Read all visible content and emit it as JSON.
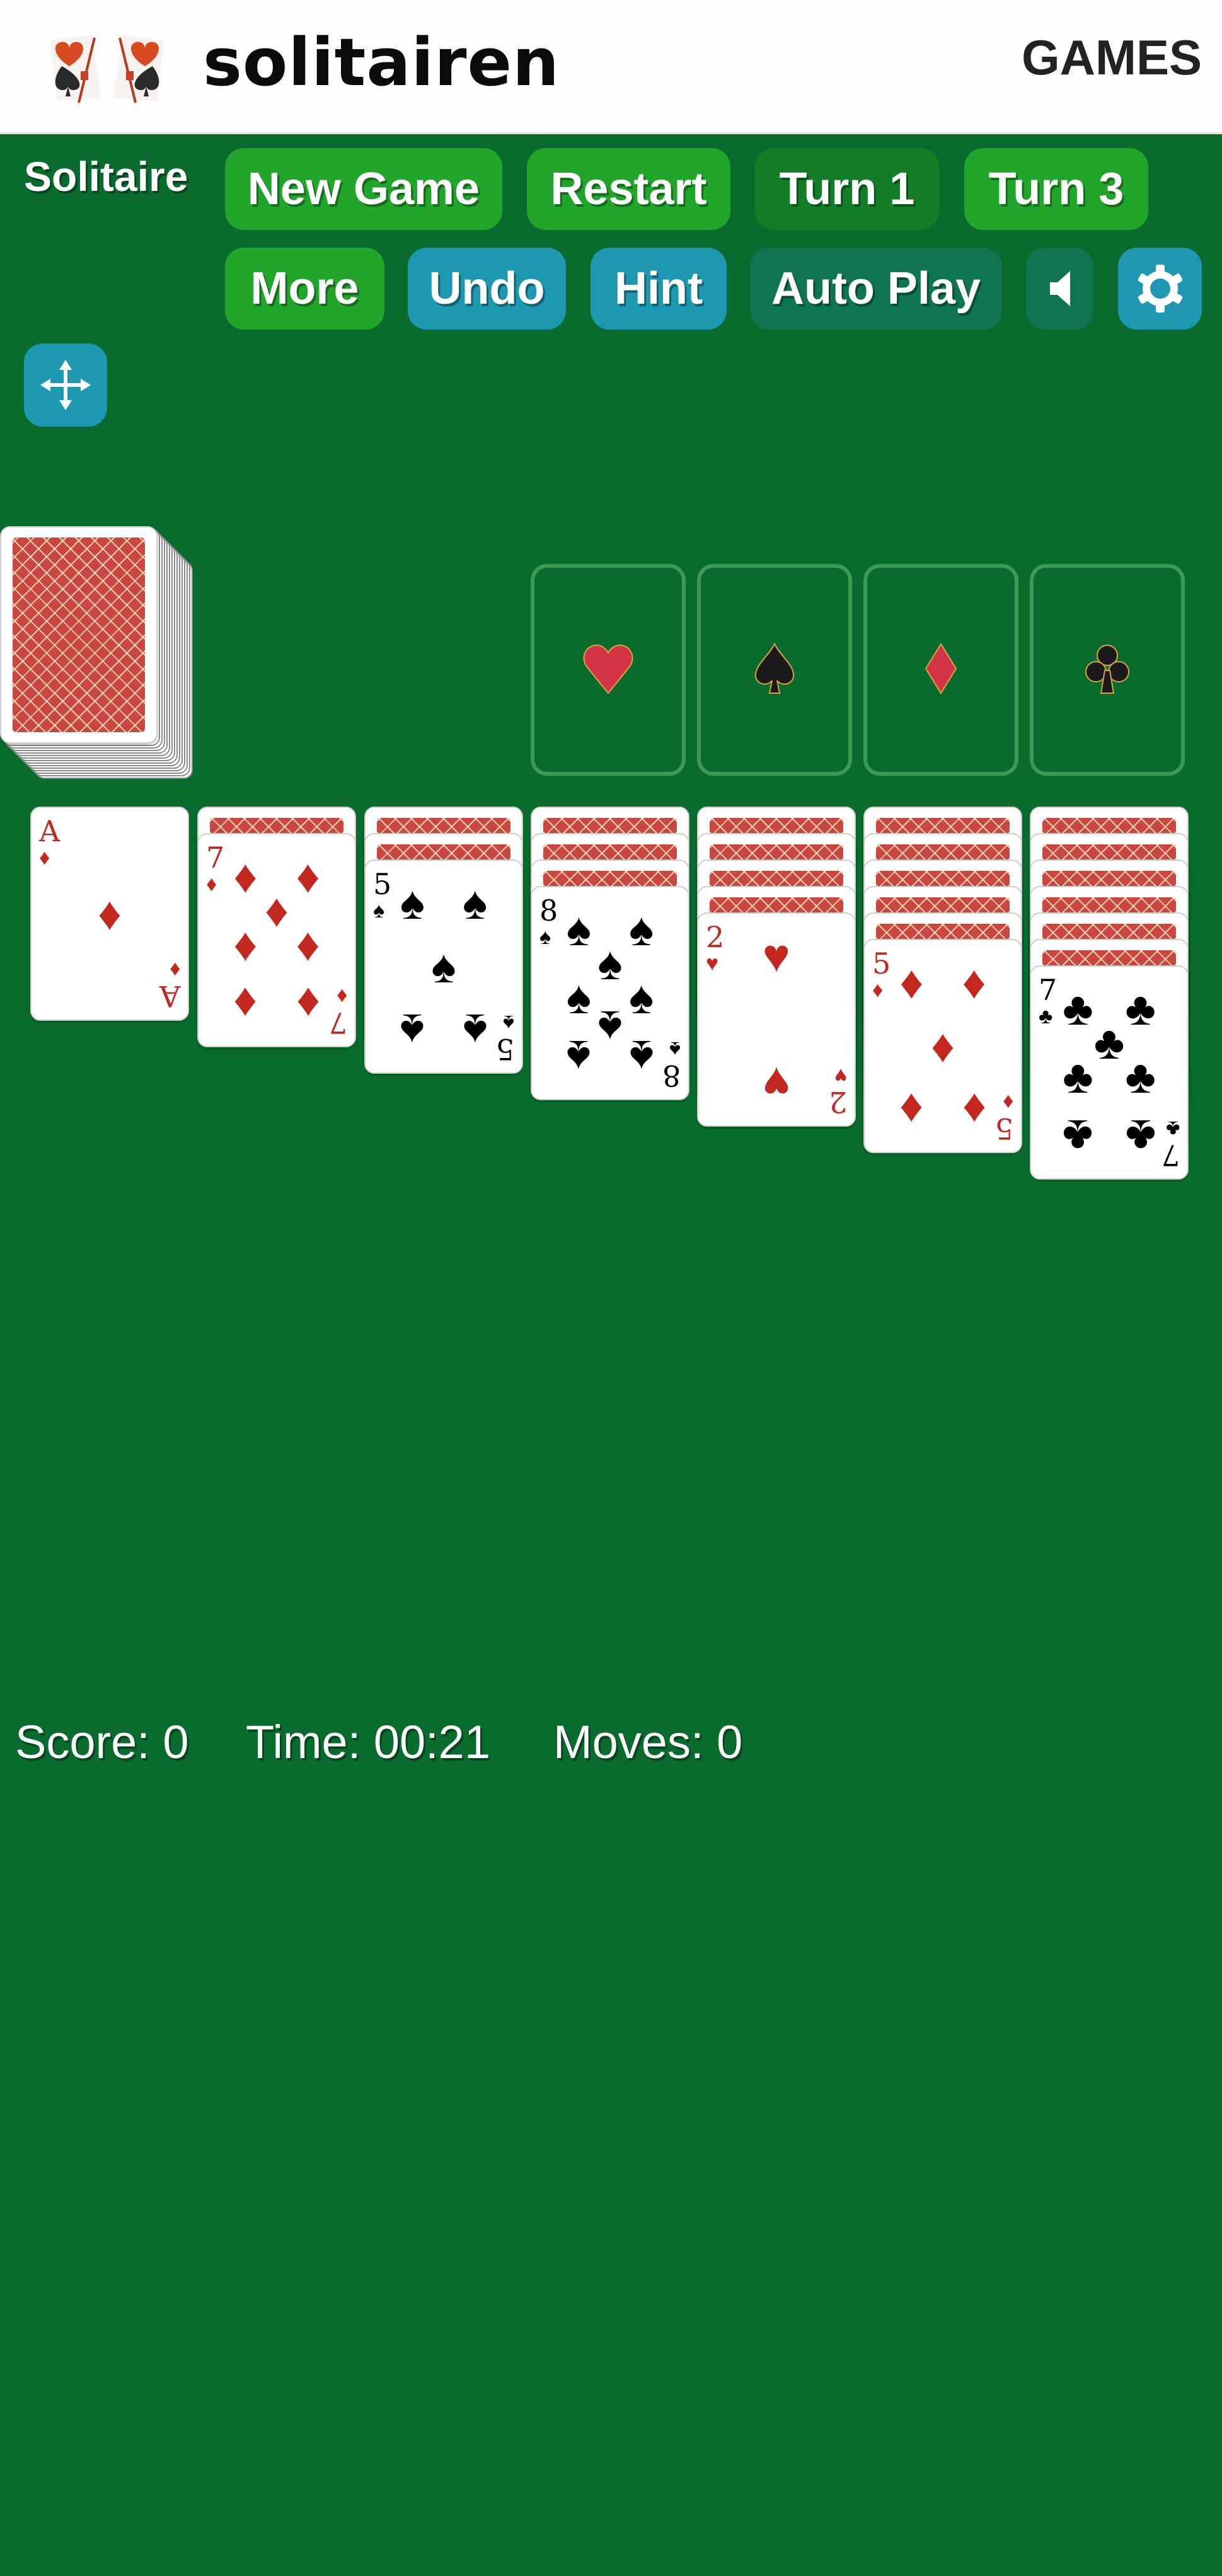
{
  "header": {
    "logo_text": "solitairen",
    "games_link": "GAMES"
  },
  "toolbar": {
    "title": "Solitaire",
    "row1": [
      {
        "label": "New Game",
        "style": "green"
      },
      {
        "label": "Restart",
        "style": "green"
      },
      {
        "label": "Turn 1",
        "style": "dkgreen"
      },
      {
        "label": "Turn 3",
        "style": "green"
      }
    ],
    "row2": [
      {
        "label": "More",
        "style": "green"
      },
      {
        "label": "Undo",
        "style": "teal"
      },
      {
        "label": "Hint",
        "style": "teal"
      },
      {
        "label": "Auto Play",
        "style": "dkteal"
      }
    ],
    "sound_icon": "speaker-icon",
    "settings_icon": "gear-icon",
    "move_icon": "move-arrows-icon"
  },
  "colors": {
    "table": "#0a6b2e",
    "btn_green": "#22a52b",
    "btn_dark_green": "#137d28",
    "btn_teal": "#1e97b0",
    "btn_dark_teal": "#0e7550",
    "card_red": "#c3281f",
    "card_back": "#c9473f",
    "foundation_border": "#3d9a52"
  },
  "stock": {
    "face": "down",
    "visible_edges": 14
  },
  "foundations": [
    {
      "suit": "hearts",
      "symbol": "♥",
      "color": "red",
      "cards": 0
    },
    {
      "suit": "spades",
      "symbol": "♠",
      "color": "black",
      "cards": 0
    },
    {
      "suit": "diamonds",
      "symbol": "♦",
      "color": "red",
      "cards": 0
    },
    {
      "suit": "clubs",
      "symbol": "♣",
      "color": "black",
      "cards": 0
    }
  ],
  "tableau": [
    {
      "face_down": 0,
      "top": {
        "rank": "A",
        "suit": "♦",
        "color": "red"
      }
    },
    {
      "face_down": 1,
      "top": {
        "rank": "7",
        "suit": "♦",
        "color": "red"
      }
    },
    {
      "face_down": 2,
      "top": {
        "rank": "5",
        "suit": "♠",
        "color": "black"
      }
    },
    {
      "face_down": 3,
      "top": {
        "rank": "8",
        "suit": "♠",
        "color": "black"
      }
    },
    {
      "face_down": 4,
      "top": {
        "rank": "2",
        "suit": "♥",
        "color": "red"
      }
    },
    {
      "face_down": 5,
      "top": {
        "rank": "5",
        "suit": "♦",
        "color": "red"
      }
    },
    {
      "face_down": 6,
      "top": {
        "rank": "7",
        "suit": "♣",
        "color": "black"
      }
    }
  ],
  "status": {
    "score": "Score: 0",
    "time": "Time: 00:21",
    "moves": "Moves: 0"
  }
}
